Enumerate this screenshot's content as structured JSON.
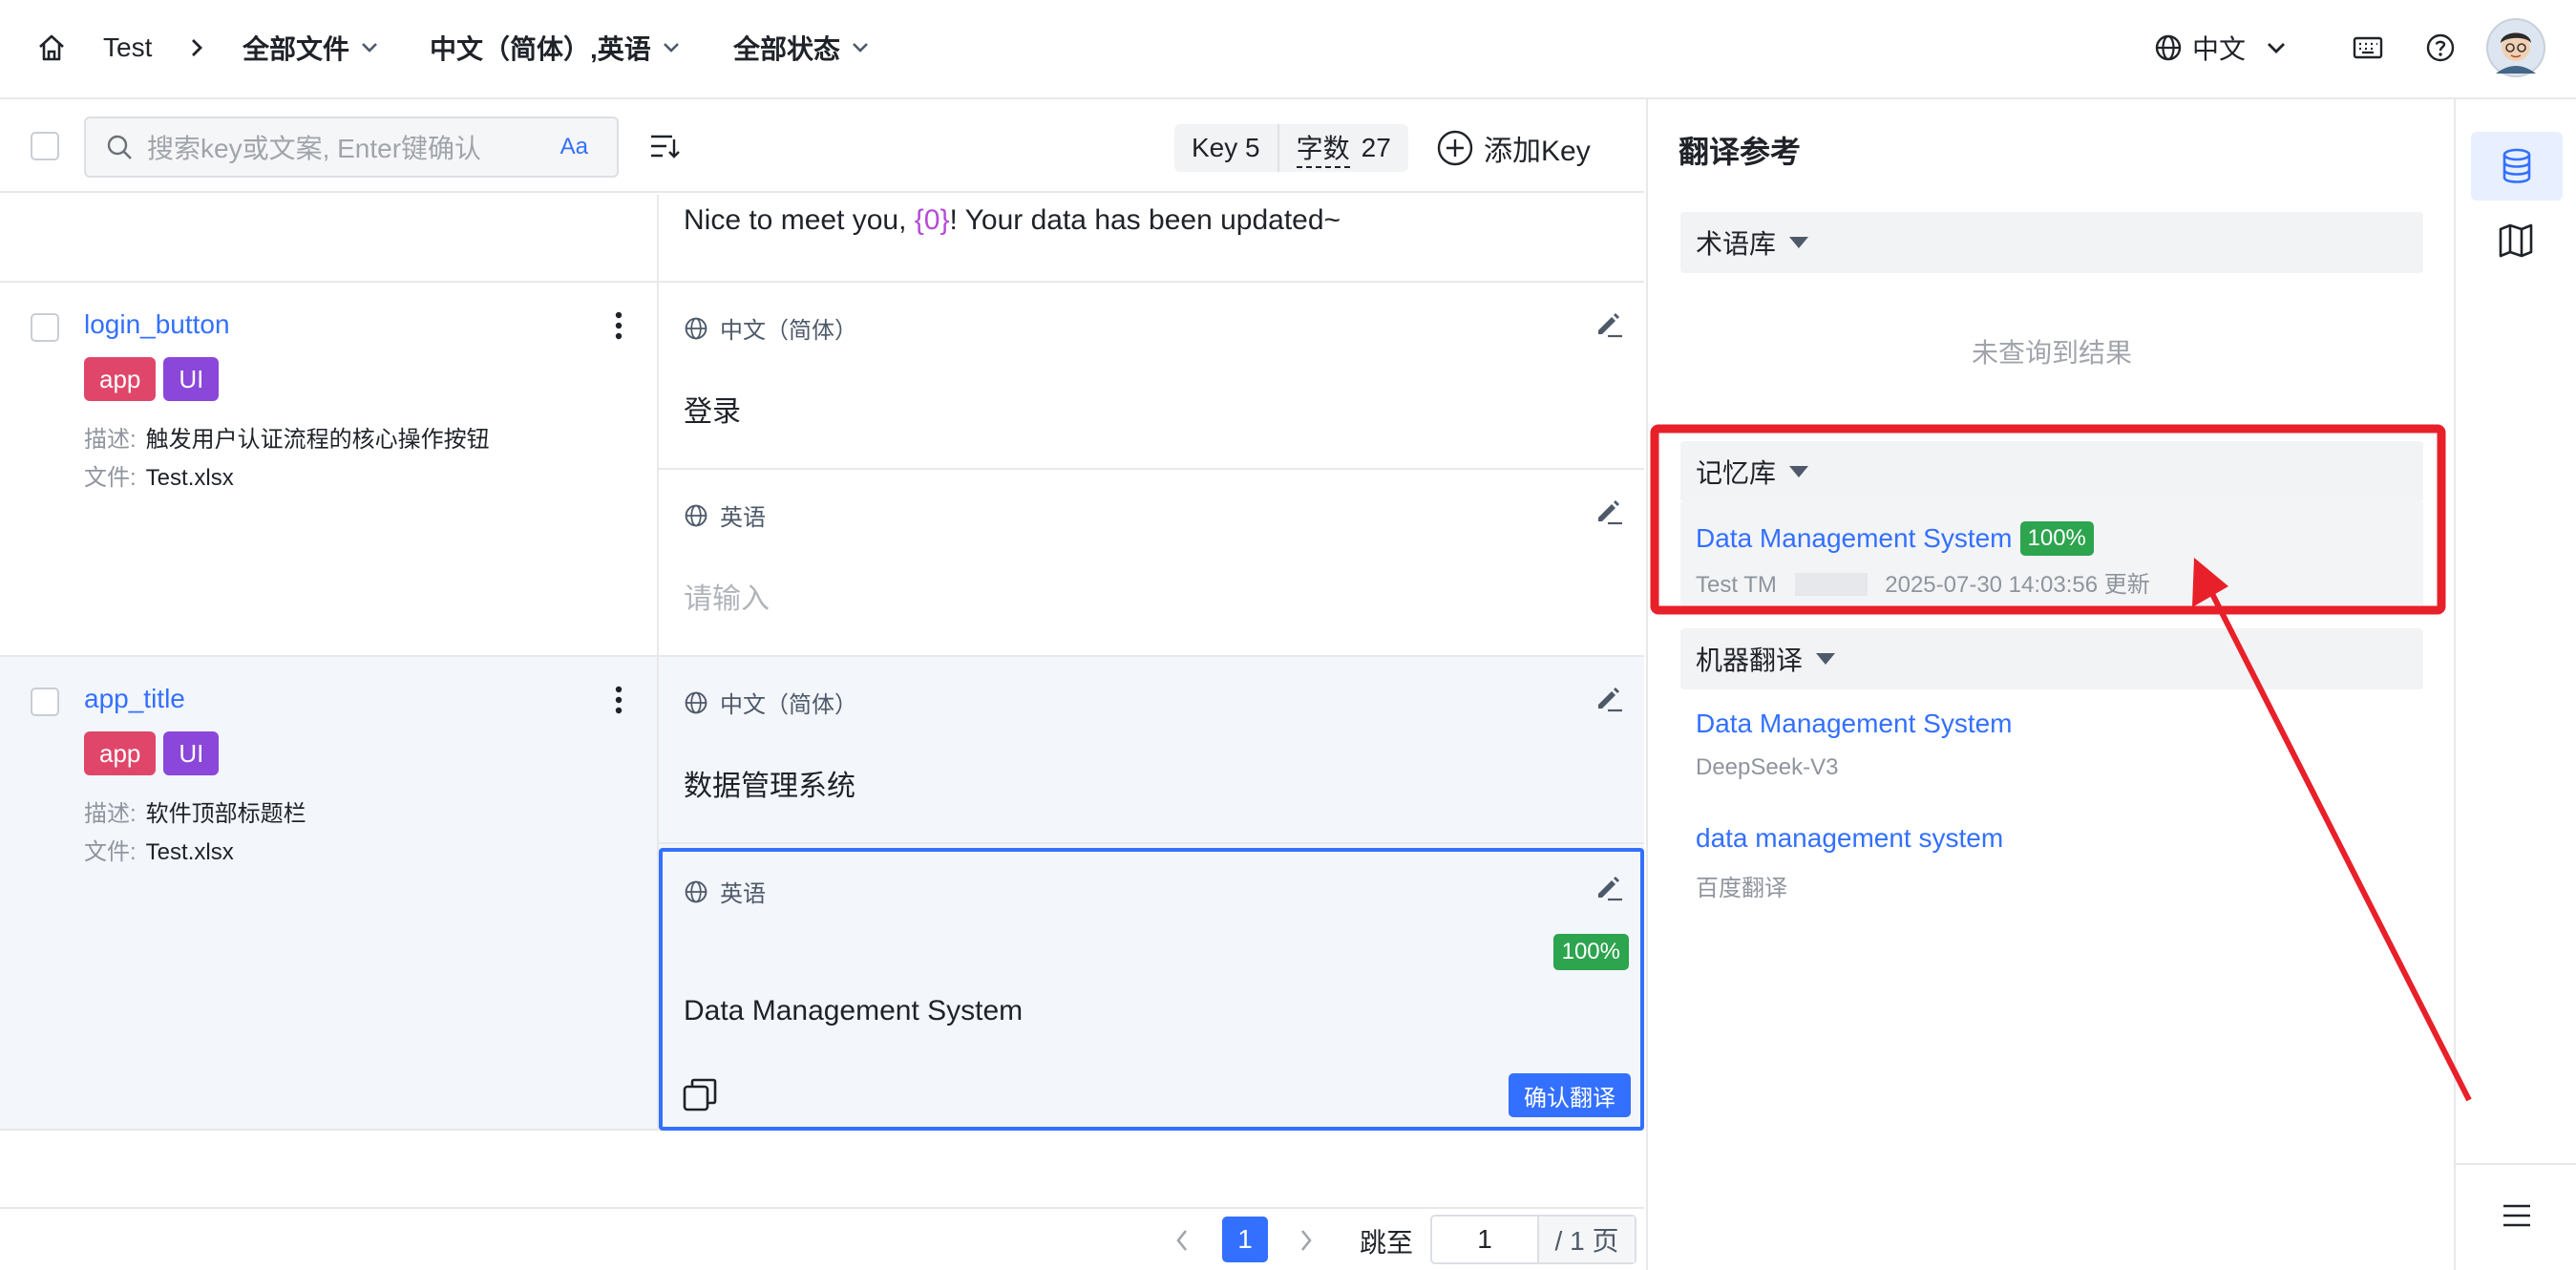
{
  "topbar": {
    "project": "Test",
    "files_filter": "全部文件",
    "lang_filter": "中文（简体）,英语",
    "status_filter": "全部状态",
    "ui_language": "中文"
  },
  "toolbar": {
    "search_placeholder": "搜索key或文案, Enter键确认",
    "case_toggle": "Aa",
    "key_label": "Key 5",
    "wordcount_label": "字数",
    "wordcount_value": "27",
    "add_key": "添加Key"
  },
  "partial_row": {
    "text_before": "Nice to meet you, ",
    "placeholder_token": "{0}",
    "text_after": "! Your data has been updated~"
  },
  "keys": [
    {
      "name": "login_button",
      "tags": [
        "app",
        "UI"
      ],
      "desc_label": "描述:",
      "desc": "触发用户认证流程的核心操作按钮",
      "file_label": "文件:",
      "file": "Test.xlsx",
      "zh_lang": "中文（简体）",
      "zh_text": "登录",
      "en_lang": "英语",
      "en_placeholder": "请输入"
    },
    {
      "name": "app_title",
      "tags": [
        "app",
        "UI"
      ],
      "desc_label": "描述:",
      "desc": "软件顶部标题栏",
      "file_label": "文件:",
      "file": "Test.xlsx",
      "zh_lang": "中文（简体）",
      "zh_text": "数据管理系统",
      "en_lang": "英语",
      "en_badge": "100%",
      "en_text": "Data Management System",
      "confirm": "确认翻译"
    }
  ],
  "pagination": {
    "current": "1",
    "jump_label": "跳至",
    "jump_value": "1",
    "total": "/ 1 页"
  },
  "reference": {
    "title": "翻译参考",
    "termbase": {
      "label": "术语库",
      "empty": "未查询到结果"
    },
    "memory": {
      "label": "记忆库",
      "match_text": "Data Management System",
      "match_badge": "100%",
      "tm_name": "Test TM",
      "updated": "2025-07-30 14:03:56 更新"
    },
    "mt": {
      "label": "机器翻译",
      "results": [
        {
          "text": "Data Management System",
          "engine": "DeepSeek-V3"
        },
        {
          "text": "data management system",
          "engine": "百度翻译"
        }
      ]
    }
  },
  "colors": {
    "accent": "#3370ff",
    "tag_app": "#e0466a",
    "tag_ui": "#8a47d9",
    "match_green": "#2da44e",
    "annotation_red": "#e8202a"
  }
}
